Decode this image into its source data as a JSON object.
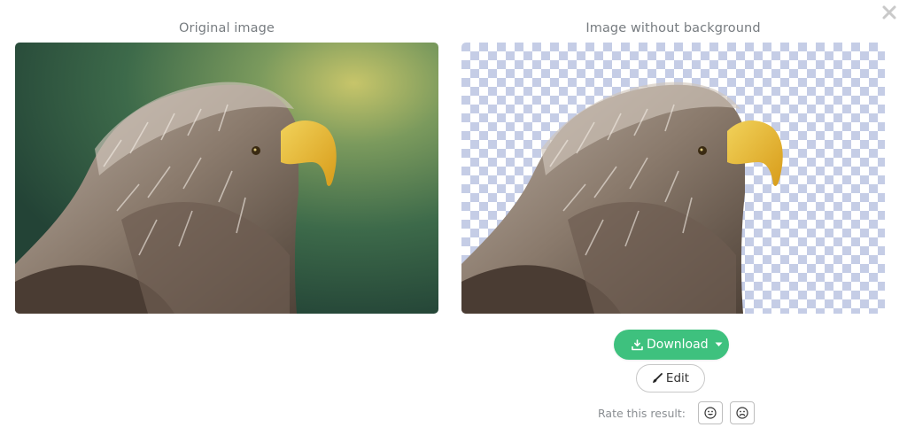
{
  "dialog": {
    "close_icon": "close-icon"
  },
  "original": {
    "title": "Original image"
  },
  "result": {
    "title": "Image without background"
  },
  "actions": {
    "download_label": "Download",
    "download_icon": "download-icon",
    "dropdown_icon": "caret-down-icon",
    "edit_label": "Edit",
    "edit_icon": "brush-icon"
  },
  "rating": {
    "label": "Rate this result:",
    "positive_icon": "smile-icon",
    "negative_icon": "frown-icon"
  },
  "colors": {
    "accent": "#3ec17e",
    "checker_light": "#ffffff",
    "checker_dark": "#c5cde6",
    "title_text": "#777c80"
  }
}
